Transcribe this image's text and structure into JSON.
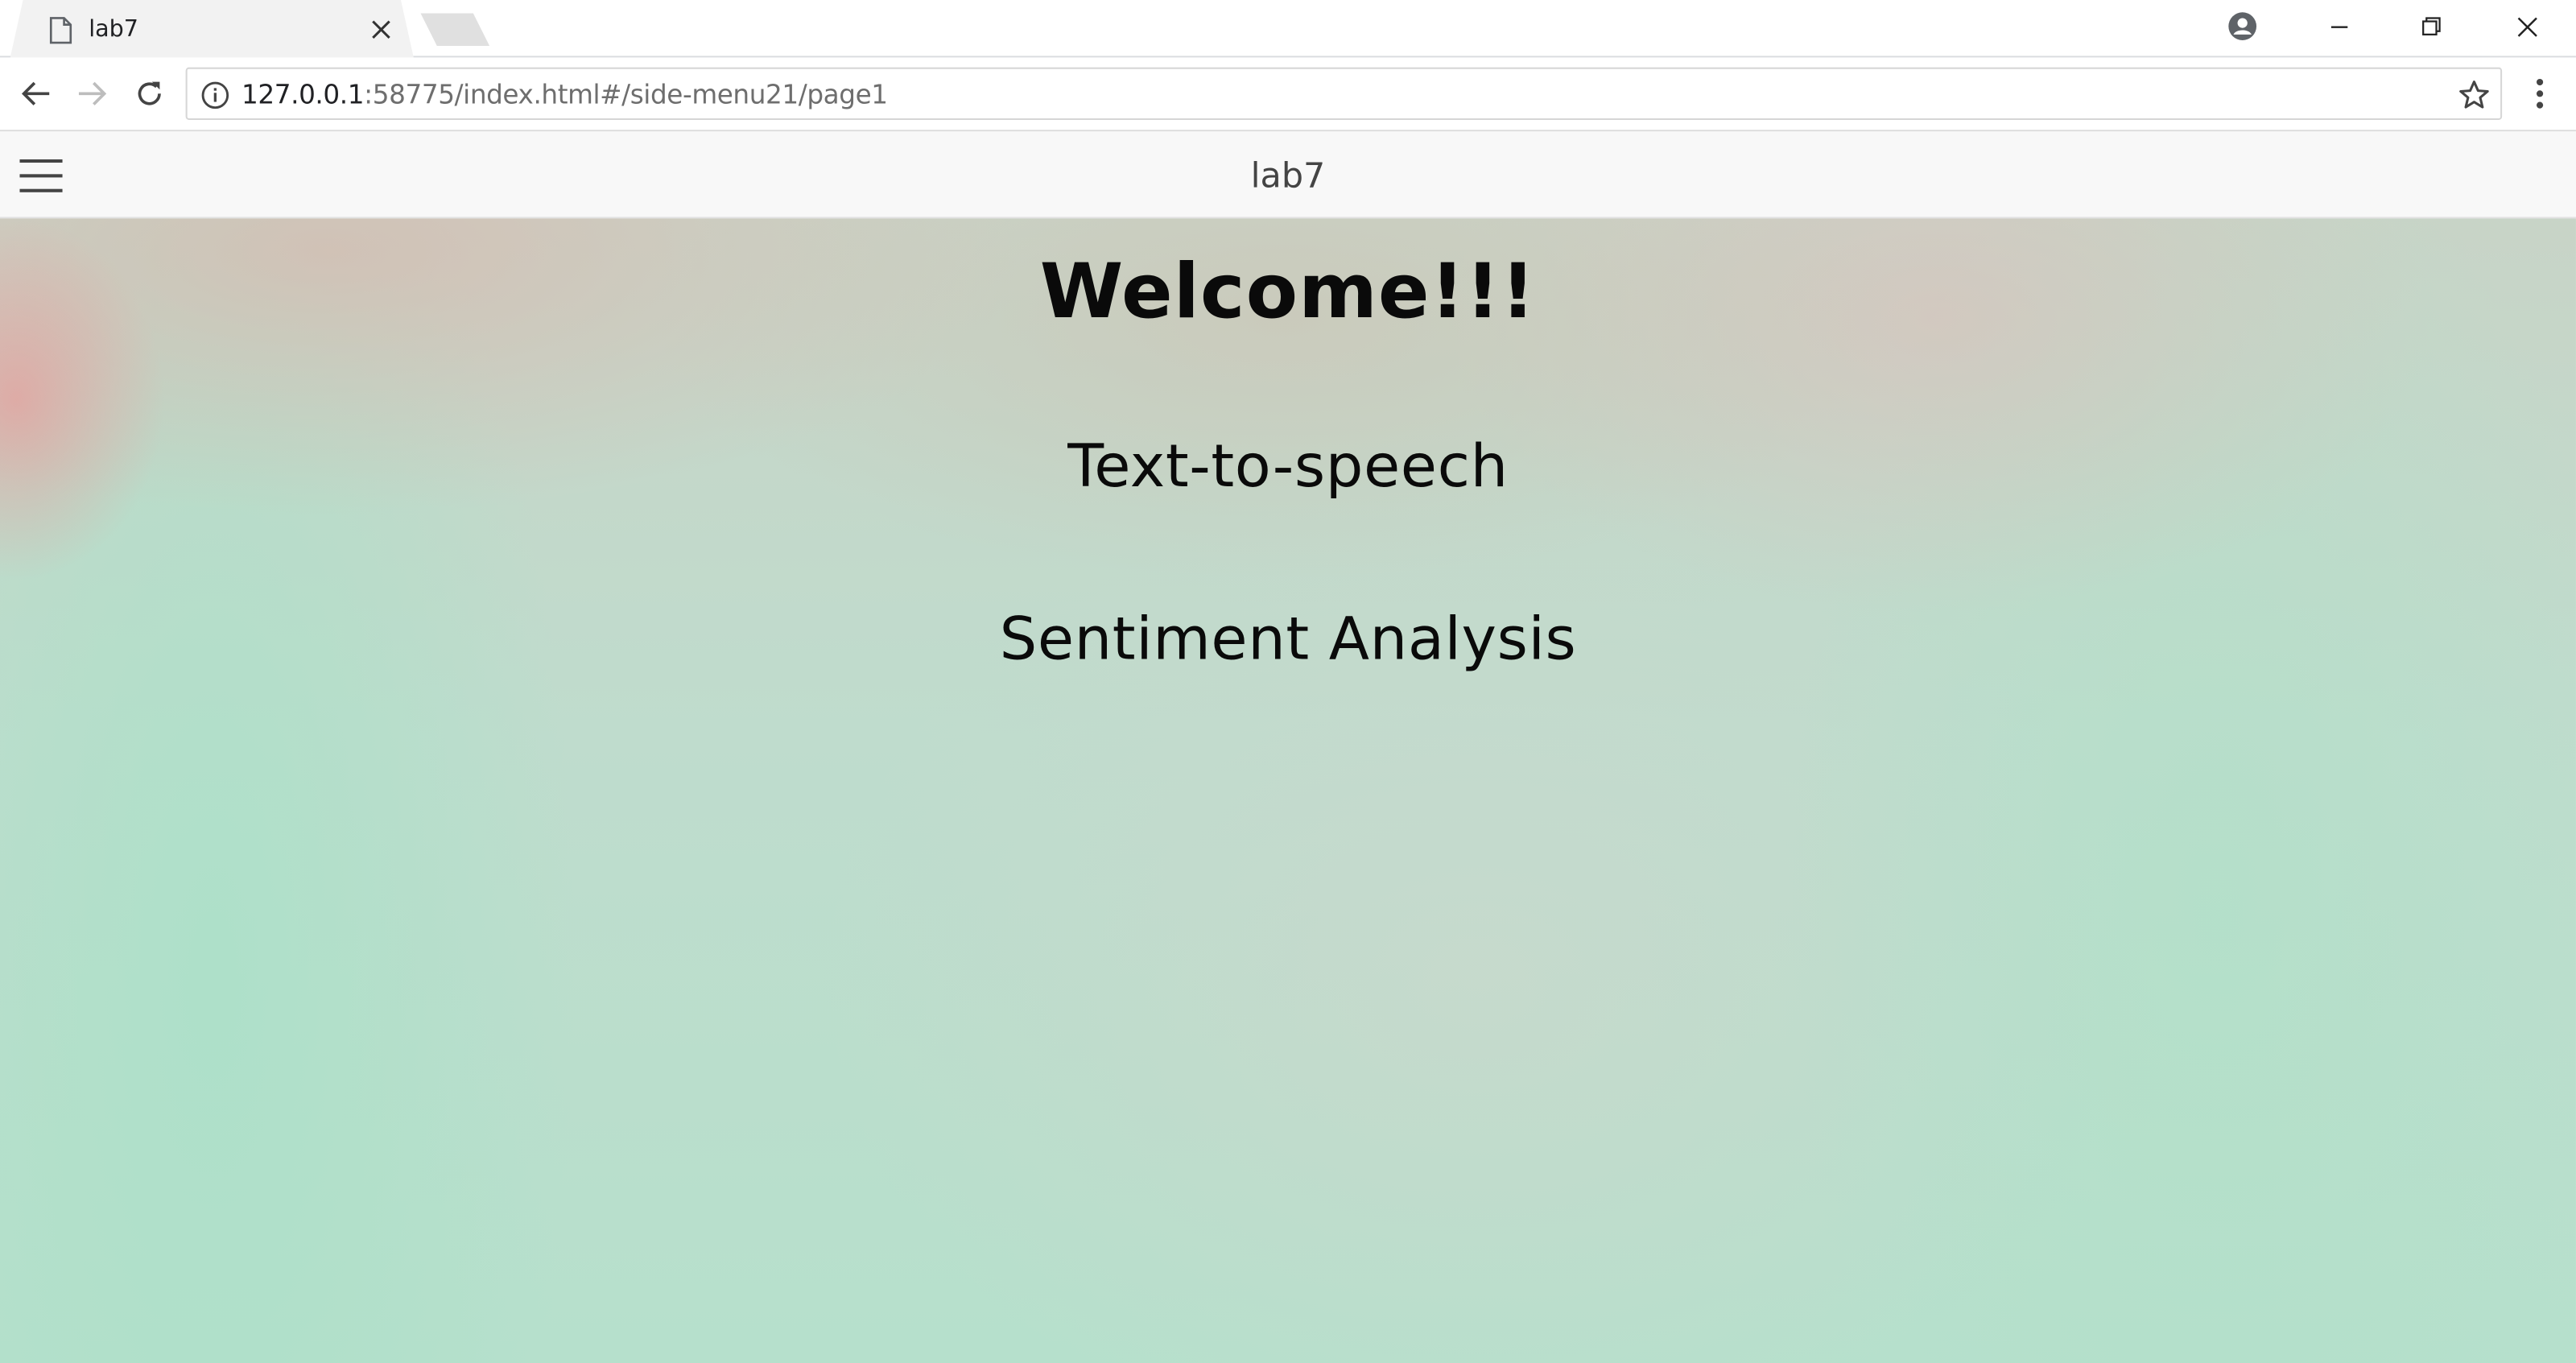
{
  "browser": {
    "tab": {
      "title": "lab7",
      "icon": "document-icon"
    },
    "url_host": "127.0.0.1",
    "url_rest": ":58775/index.html#/side-menu21/page1"
  },
  "app": {
    "title": "lab7",
    "menu_icon": "hamburger-icon"
  },
  "content": {
    "welcome": "Welcome!!!",
    "item1": "Text-to-speech",
    "item2": "Sentiment Analysis"
  },
  "colors": {
    "header_bg": "#f8f8f8",
    "content_tint": "#b6e0cc",
    "text": "#0a0a0a"
  }
}
